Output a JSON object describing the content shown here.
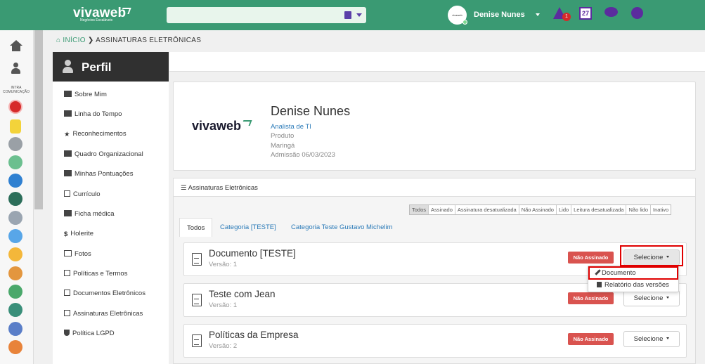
{
  "topbar": {
    "logo": "vivaweb",
    "logo_sub": "Negócios Escaláveis",
    "avatar_text": "vivaweb",
    "user_name": "Denise Nunes",
    "alert_count": "1",
    "calendar_day": "27"
  },
  "rail": {
    "intra_label": "INTRA COMUNICAÇÃO"
  },
  "breadcrumb": {
    "home": "INÍCIO",
    "current": "ASSINATURAS ELETRÔNICAS"
  },
  "sidebar": {
    "title": "Perfil",
    "items": [
      {
        "label": "Sobre Mim"
      },
      {
        "label": "Linha do Tempo"
      },
      {
        "label": "Reconhecimentos"
      },
      {
        "label": "Quadro Organizacional"
      },
      {
        "label": "Minhas Pontuações"
      },
      {
        "label": "Currículo"
      },
      {
        "label": "Ficha médica"
      },
      {
        "label": "Holerite"
      },
      {
        "label": "Fotos"
      },
      {
        "label": "Políticas e Termos"
      },
      {
        "label": "Documentos Eletrônicos"
      },
      {
        "label": "Assinaturas Eletrônicas"
      },
      {
        "label": "Política LGPD"
      }
    ]
  },
  "profile": {
    "logo": "vivaweb",
    "name": "Denise Nunes",
    "role": "Analista de TI",
    "department": "Produto",
    "city": "Maringá",
    "admission": "Admissão 06/03/2023"
  },
  "panel": {
    "title": "Assinaturas Eletrônicas",
    "filters": [
      "Todos",
      "Assinado",
      "Assinatura desatualizada",
      "Não Assinado",
      "Lido",
      "Leitura desatualizada",
      "Não lido",
      "Inativo"
    ],
    "tabs": [
      "Todos",
      "Categoria [TESTE]",
      "Categoria Teste Gustavo Michelim"
    ],
    "documents": [
      {
        "title": "Documento [TESTE]",
        "version": "Versão: 1",
        "status": "Não Assinado",
        "action": "Selecione"
      },
      {
        "title": "Teste com Jean",
        "version": "Versão: 1",
        "status": "Não Assinado",
        "action": "Selecione"
      },
      {
        "title": "Políticas da Empresa",
        "version": "Versão: 2",
        "status": "Não Assinado",
        "action": "Selecione"
      }
    ],
    "dropdown": [
      "Documento",
      "Relatório das versões"
    ]
  },
  "colors": {
    "topbar": "#3a9a73",
    "accent": "#5b2c9e",
    "danger": "#d9534f",
    "highlight": "#e00000"
  }
}
